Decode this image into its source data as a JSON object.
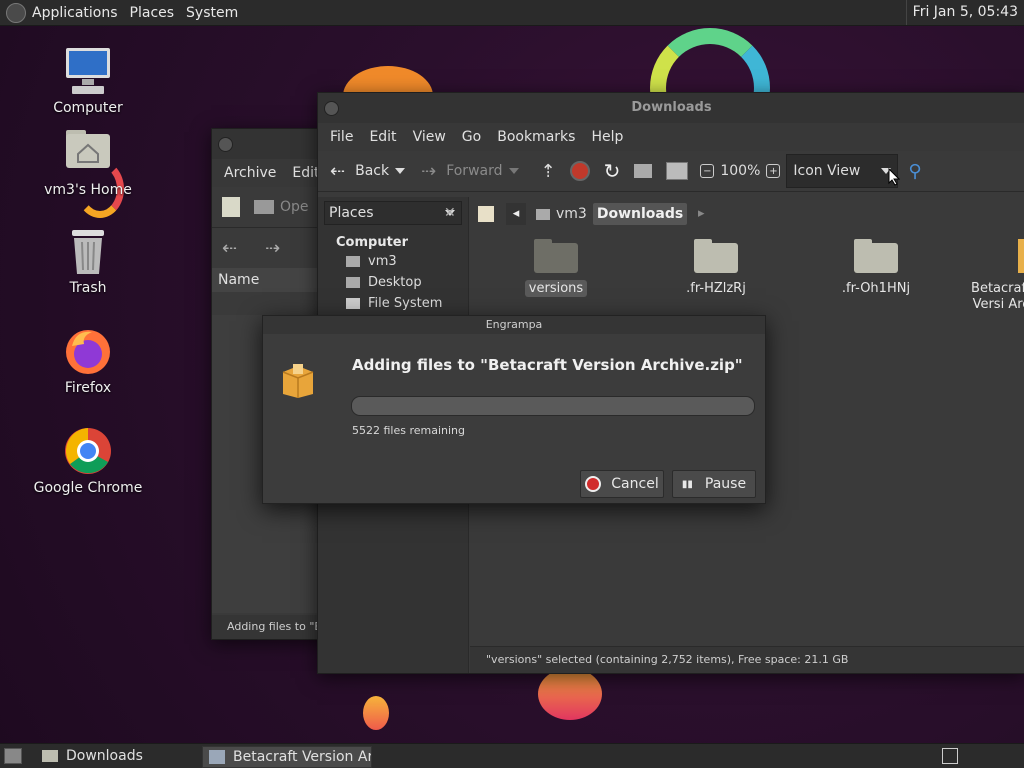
{
  "top_panel": {
    "menus": [
      "Applications",
      "Places",
      "System"
    ],
    "clock": "Fri Jan  5, 05:43"
  },
  "desktop_icons": [
    {
      "label": "Computer",
      "icon": "computer-icon"
    },
    {
      "label": "vm3's Home",
      "icon": "home-folder-icon"
    },
    {
      "label": "Trash",
      "icon": "trash-icon"
    },
    {
      "label": "Firefox",
      "icon": "firefox-icon"
    },
    {
      "label": "Google Chrome",
      "icon": "chrome-icon"
    }
  ],
  "engrampa_back": {
    "menus": [
      "Archive",
      "Edit"
    ],
    "open_label": "Ope",
    "column_name": "Name",
    "status": "Adding files to \"Be"
  },
  "file_manager": {
    "title": "Downloads",
    "menus": [
      "File",
      "Edit",
      "View",
      "Go",
      "Bookmarks",
      "Help"
    ],
    "toolbar": {
      "back": "Back",
      "forward": "Forward",
      "zoom": "100%",
      "view_mode": "Icon View"
    },
    "sidebar": {
      "selector": "Places",
      "section": "Computer",
      "items": [
        "vm3",
        "Desktop",
        "File System"
      ]
    },
    "path": [
      "vm3",
      "Downloads"
    ],
    "files": [
      "versions",
      ".fr-HZlzRj",
      ".fr-Oh1HNj",
      "Betacraft Versi Arc"
    ],
    "status": "\"versions\" selected (containing 2,752 items), Free space: 21.1 GB"
  },
  "dialog": {
    "title": "Engrampa",
    "heading": "Adding files to \"Betacraft Version Archive.zip\"",
    "progress": 0.0,
    "remaining": "5522 files remaining",
    "cancel_label": "Cancel",
    "pause_label": "Pause"
  },
  "taskbar": {
    "tasks": [
      "Downloads",
      "Betacraft Version Ar..."
    ]
  },
  "colors": {
    "accent_red": "#d12c2c",
    "folder": "#bdbdb0",
    "archive": "#e8b04a"
  }
}
